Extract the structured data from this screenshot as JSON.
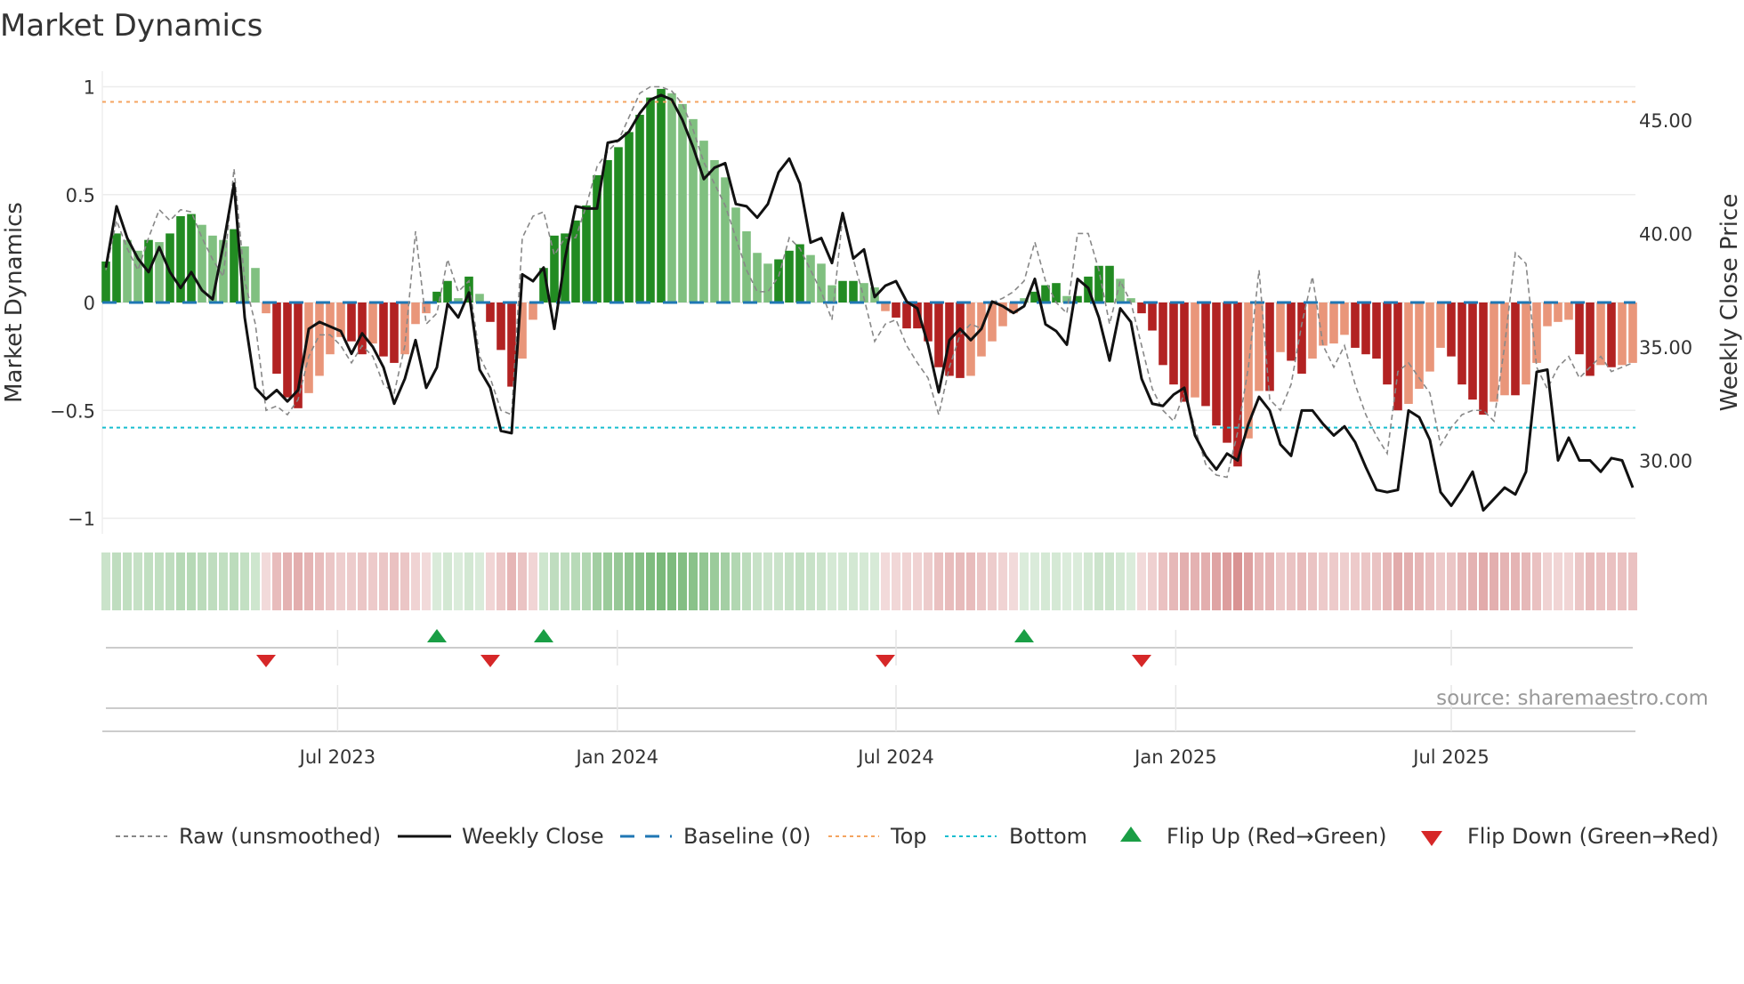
{
  "title": "Market Dynamics",
  "source": "source: sharemaestro.com",
  "colors": {
    "up_strong": "#228b22",
    "up_weak": "#80c080",
    "down_strong": "#b22222",
    "down_weak": "#e9967a",
    "top": "#f4a460",
    "bottom": "#17becf",
    "baseline": "#1f77b4",
    "raw": "#888888",
    "close": "#111111",
    "flip_up": "#1a9e45",
    "flip_down": "#d62728"
  },
  "chart_data": {
    "type": "bar",
    "title": "Market Dynamics",
    "ylabel": "Market Dynamics",
    "ylabel_right": "Weekly Close Price",
    "ylim": [
      -1,
      1
    ],
    "ylim_right": [
      27.45,
      46.47
    ],
    "yticks": [
      {
        "v": 1,
        "label": "1"
      },
      {
        "v": 0.5,
        "label": "0.5"
      },
      {
        "v": 0,
        "label": "0"
      },
      {
        "v": -0.5,
        "label": "−0.5"
      },
      {
        "v": -1,
        "label": "−1"
      }
    ],
    "yticks_right": [
      {
        "v": 45,
        "label": "45.00"
      },
      {
        "v": 40,
        "label": "40.00"
      },
      {
        "v": 35,
        "label": "35.00"
      },
      {
        "v": 30,
        "label": "30.00"
      }
    ],
    "xticks": [
      {
        "week": 21.7,
        "label": "Jul 2023"
      },
      {
        "week": 47.9,
        "label": "Jan 2024"
      },
      {
        "week": 74.0,
        "label": "Jul 2024"
      },
      {
        "week": 100.2,
        "label": "Jan 2025"
      },
      {
        "week": 126.0,
        "label": "Jul 2025"
      }
    ],
    "top_level": 0.93,
    "bottom_level": -0.58,
    "baseline": 0,
    "momentum": [
      0.19,
      0.32,
      0.29,
      0.24,
      0.29,
      0.28,
      0.32,
      0.4,
      0.41,
      0.36,
      0.31,
      0.29,
      0.34,
      0.26,
      0.16,
      -0.05,
      -0.33,
      -0.44,
      -0.49,
      -0.42,
      -0.34,
      -0.24,
      -0.16,
      -0.18,
      -0.24,
      -0.19,
      -0.25,
      -0.28,
      -0.24,
      -0.1,
      -0.05,
      0.05,
      0.1,
      0.02,
      0.12,
      0.04,
      -0.09,
      -0.22,
      -0.39,
      -0.26,
      -0.08,
      0.16,
      0.31,
      0.32,
      0.38,
      0.45,
      0.59,
      0.66,
      0.72,
      0.79,
      0.87,
      0.95,
      0.99,
      0.97,
      0.92,
      0.85,
      0.75,
      0.66,
      0.58,
      0.44,
      0.33,
      0.23,
      0.18,
      0.2,
      0.24,
      0.27,
      0.22,
      0.18,
      0.08,
      0.1,
      0.1,
      0.09,
      0.07,
      -0.04,
      -0.07,
      -0.12,
      -0.12,
      -0.18,
      -0.3,
      -0.34,
      -0.35,
      -0.34,
      -0.25,
      -0.18,
      -0.11,
      -0.05,
      0.02,
      0.05,
      0.08,
      0.09,
      0.03,
      0.03,
      0.12,
      0.17,
      0.17,
      0.11,
      0.02,
      -0.05,
      -0.13,
      -0.29,
      -0.38,
      -0.46,
      -0.44,
      -0.48,
      -0.57,
      -0.65,
      -0.76,
      -0.63,
      -0.41,
      -0.41,
      -0.23,
      -0.27,
      -0.33,
      -0.26,
      -0.2,
      -0.19,
      -0.15,
      -0.21,
      -0.24,
      -0.26,
      -0.38,
      -0.5,
      -0.47,
      -0.4,
      -0.32,
      -0.21,
      -0.25,
      -0.38,
      -0.45,
      -0.52,
      -0.46,
      -0.43,
      -0.43,
      -0.38,
      -0.28,
      -0.11,
      -0.09,
      -0.08,
      -0.24,
      -0.34,
      -0.29,
      -0.3,
      -0.29,
      -0.28
    ],
    "raw": [
      0.15,
      0.38,
      0.25,
      0.15,
      0.3,
      0.43,
      0.38,
      0.43,
      0.42,
      0.3,
      0.2,
      0.12,
      0.62,
      0.1,
      -0.1,
      -0.5,
      -0.48,
      -0.52,
      -0.45,
      -0.25,
      -0.15,
      -0.15,
      -0.2,
      -0.28,
      -0.2,
      -0.25,
      -0.38,
      -0.42,
      -0.2,
      0.33,
      -0.1,
      -0.05,
      0.2,
      0.05,
      0.1,
      -0.25,
      -0.35,
      -0.5,
      -0.52,
      0.3,
      0.4,
      0.42,
      0.22,
      0.3,
      0.3,
      0.45,
      0.63,
      0.7,
      0.75,
      0.86,
      0.97,
      1.0,
      1.0,
      0.98,
      0.92,
      0.8,
      0.65,
      0.55,
      0.45,
      0.3,
      0.15,
      0.05,
      0.05,
      0.12,
      0.3,
      0.25,
      0.15,
      0.05,
      -0.08,
      0.4,
      0.2,
      0.02,
      -0.18,
      -0.1,
      -0.08,
      -0.2,
      -0.28,
      -0.35,
      -0.52,
      -0.3,
      -0.15,
      -0.1,
      -0.12,
      0.0,
      0.02,
      0.05,
      0.1,
      0.28,
      0.1,
      0.0,
      -0.05,
      0.32,
      0.32,
      0.15,
      -0.1,
      0.1,
      0.0,
      -0.2,
      -0.4,
      -0.5,
      -0.55,
      -0.42,
      -0.58,
      -0.75,
      -0.8,
      -0.81,
      -0.6,
      -0.3,
      0.15,
      -0.45,
      -0.5,
      -0.38,
      -0.1,
      0.12,
      -0.2,
      -0.3,
      -0.2,
      -0.38,
      -0.52,
      -0.62,
      -0.7,
      -0.32,
      -0.28,
      -0.35,
      -0.42,
      -0.66,
      -0.58,
      -0.52,
      -0.5,
      -0.5,
      -0.55,
      -0.2,
      0.23,
      0.18,
      -0.3,
      -0.4,
      -0.3,
      -0.25,
      -0.35,
      -0.3,
      -0.25,
      -0.32,
      -0.3,
      -0.28
    ],
    "close": [
      38.5,
      41.2,
      39.8,
      38.9,
      38.3,
      39.4,
      38.3,
      37.6,
      38.3,
      37.5,
      37.1,
      39.5,
      42.2,
      36.3,
      33.2,
      32.7,
      33.1,
      32.6,
      33.1,
      35.8,
      36.1,
      35.9,
      35.7,
      34.7,
      35.6,
      35.0,
      34.1,
      32.5,
      33.6,
      35.3,
      33.2,
      34.1,
      36.9,
      36.3,
      37.4,
      34.0,
      33.2,
      31.3,
      31.2,
      38.2,
      37.9,
      38.5,
      35.8,
      38.9,
      41.2,
      41.1,
      41.1,
      44.0,
      44.1,
      44.5,
      45.3,
      45.9,
      46.1,
      45.9,
      45.0,
      43.8,
      42.4,
      42.9,
      43.1,
      41.3,
      41.2,
      40.7,
      41.3,
      42.7,
      43.3,
      42.2,
      39.6,
      39.8,
      38.7,
      40.9,
      38.9,
      39.3,
      37.2,
      37.7,
      37.9,
      37.0,
      36.7,
      35.1,
      33.0,
      35.3,
      35.8,
      35.3,
      35.8,
      37.0,
      36.8,
      36.5,
      36.8,
      38.0,
      36.0,
      35.7,
      35.1,
      38.0,
      37.6,
      36.3,
      34.4,
      36.7,
      36.1,
      33.6,
      32.5,
      32.4,
      32.9,
      33.2,
      31.1,
      30.2,
      29.6,
      30.3,
      30.0,
      31.6,
      32.8,
      32.2,
      30.7,
      30.2,
      32.2,
      32.2,
      31.6,
      31.1,
      31.5,
      30.8,
      29.7,
      28.7,
      28.6,
      28.7,
      32.2,
      31.9,
      30.9,
      28.6,
      28.0,
      28.7,
      29.5,
      27.8,
      28.3,
      28.8,
      28.5,
      29.5,
      33.9,
      34.0,
      30.0,
      31.0,
      30.0,
      30.0,
      29.5,
      30.1,
      30.0,
      28.8
    ],
    "flips_up": [
      31,
      41,
      86
    ],
    "flips_down": [
      15,
      36,
      73,
      97
    ],
    "legend": {
      "raw": "Raw (unsmoothed)",
      "close": "Weekly Close",
      "baseline": "Baseline (0)",
      "top": "Top",
      "bottom": "Bottom",
      "flip_up": "Flip Up (Red→Green)",
      "flip_down": "Flip Down (Green→Red)"
    },
    "legend_position": "bottom"
  }
}
